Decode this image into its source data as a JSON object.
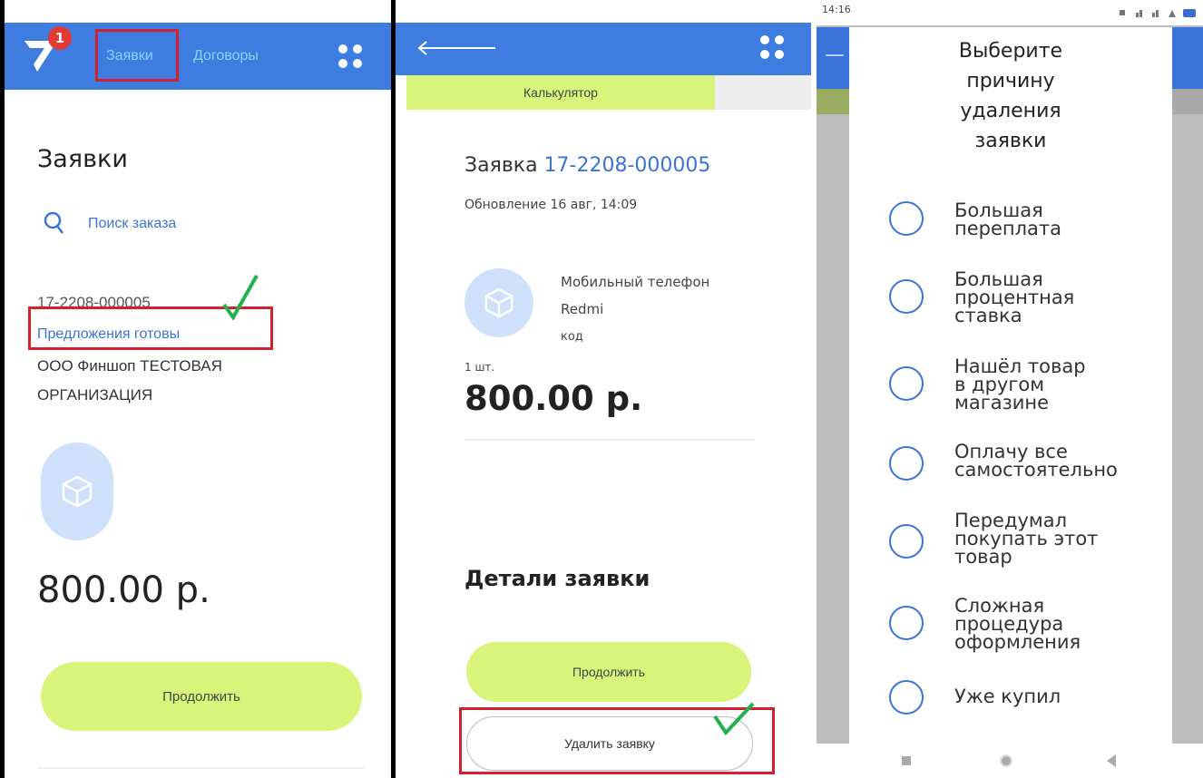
{
  "screen1": {
    "badge_count": "1",
    "tabs": [
      "Заявки",
      "Договоры"
    ],
    "page_title": "Заявки",
    "search_placeholder": "Поиск заказа",
    "order_number": "17-2208-000005",
    "order_status": "Предложения готовы",
    "org_line1": "ООО Финшоп ТЕСТОВАЯ",
    "org_line2": "ОРГАНИЗАЦИЯ",
    "price": "800.00 р.",
    "continue_label": "Продолжить"
  },
  "screen2": {
    "tab_calculator": "Калькулятор",
    "order_label": "Заявка",
    "order_number": "17-2208-000005",
    "updated": "Обновление 16 авг, 14:09",
    "product_line1": "Мобильный телефон",
    "product_line2": "Redmi",
    "product_line3": "код",
    "quantity": "1 шт.",
    "price": "800.00 р.",
    "details_heading": "Детали заявки",
    "continue_label": "Продолжить",
    "delete_label": "Удалить заявку"
  },
  "screen3": {
    "status_time": "14:16",
    "dialog_title": [
      "Выберите",
      "причину",
      "удаления",
      "заявки"
    ],
    "reasons": [
      [
        "Большая",
        "переплата"
      ],
      [
        "Большая",
        "процентная",
        "ставка"
      ],
      [
        "Нашёл товар",
        "в другом",
        "магазине"
      ],
      [
        "Оплачу все",
        "самостоятельно"
      ],
      [
        "Передумал",
        "покупать этот",
        "товар"
      ],
      [
        "Сложная",
        "процедура",
        "оформления"
      ],
      [
        "Уже купил"
      ]
    ]
  },
  "colors": {
    "header_blue": "#3e7ce0",
    "link_blue": "#3a74d8",
    "lime": "#d9f47a",
    "highlight_red": "#d3202c",
    "check_green": "#22b14c"
  },
  "icons": [
    "app-logo-icon",
    "grid-menu-icon",
    "search-icon",
    "box-icon",
    "back-arrow-icon",
    "radio-icon",
    "checkmark-icon"
  ]
}
